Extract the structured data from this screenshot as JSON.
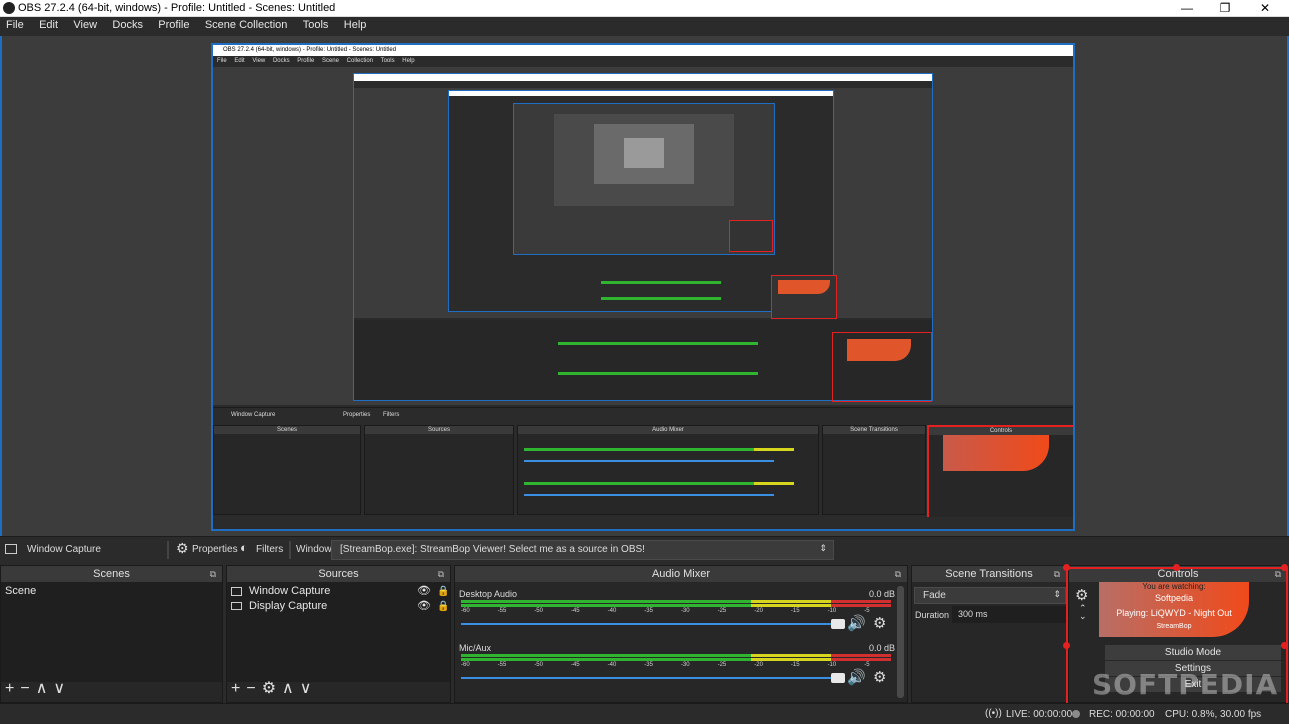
{
  "window": {
    "title": "OBS 27.2.4 (64-bit, windows) - Profile: Untitled - Scenes: Untitled",
    "minimize": "—",
    "maximize": "❐",
    "close": "✕"
  },
  "menu": [
    "File",
    "Edit",
    "View",
    "Docks",
    "Profile",
    "Scene Collection",
    "Tools",
    "Help"
  ],
  "source_bar": {
    "source_name": "Window Capture",
    "properties_label": "Properties",
    "filters_label": "Filters",
    "window_label": "Window",
    "window_value": "[StreamBop.exe]: StreamBop Viewer! Select me as a source in OBS!"
  },
  "scenes": {
    "title": "Scenes",
    "items": [
      "Scene"
    ]
  },
  "sources": {
    "title": "Sources",
    "items": [
      "Window Capture",
      "Display Capture"
    ]
  },
  "audio_mixer": {
    "title": "Audio Mixer",
    "ticks": [
      "-60",
      "-55",
      "-50",
      "-45",
      "-40",
      "-35",
      "-30",
      "-25",
      "-20",
      "-15",
      "-10",
      "-5",
      "0"
    ],
    "channels": [
      {
        "name": "Desktop Audio",
        "level": "0.0 dB"
      },
      {
        "name": "Mic/Aux",
        "level": "0.0 dB"
      }
    ]
  },
  "scene_transitions": {
    "title": "Scene Transitions",
    "transition": "Fade",
    "duration_label": "Duration",
    "duration_value": "300 ms"
  },
  "controls": {
    "title": "Controls",
    "watching_label": "You are watching:",
    "channel": "Softpedia",
    "playing": "Playing: LiQWYD - Night Out",
    "brand": "StreamBop",
    "studio_mode": "Studio Mode",
    "settings": "Settings",
    "exit": "Exit"
  },
  "status": {
    "live": "LIVE: 00:00:00",
    "rec": "REC: 00:00:00",
    "cpu": "CPU: 0.8%, 30.00 fps"
  },
  "preview": {
    "title": "OBS 27.2.4 (64-bit, windows) - Profile: Untitled - Scenes: Untitled",
    "menu": [
      "File",
      "Edit",
      "View",
      "Docks",
      "Profile",
      "Scene Collection",
      "Tools",
      "Help"
    ]
  },
  "watermark": "SOFTPEDIA",
  "colors": {
    "accent": "#1e6fc4",
    "selection": "#e52020",
    "meter_green": "#2fb52f",
    "meter_yellow": "#d6d61e",
    "meter_red": "#d23030",
    "streambop_orange": "#f04a1a"
  }
}
